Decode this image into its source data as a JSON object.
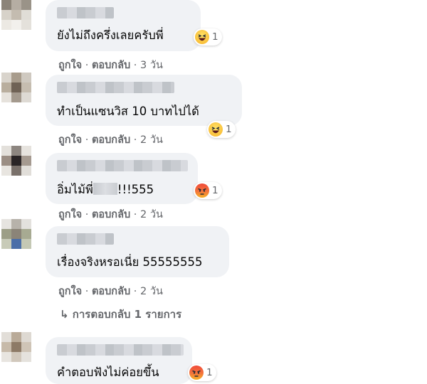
{
  "comments": [
    {
      "text": "ยังไม่ถึงครึ่งเลยครับพี่",
      "reaction": {
        "icon": "haha-emoji-icon",
        "count": "1"
      },
      "actions": {
        "like": "ถูกใจ",
        "sep": " · ",
        "reply": "ตอบกลับ",
        "time": "3 วัน"
      }
    },
    {
      "text": "ทำเป็นแซนวิส 10 บาทไปได้",
      "reaction": {
        "icon": "haha-emoji-icon",
        "count": "1"
      },
      "actions": {
        "like": "ถูกใจ",
        "sep": " · ",
        "reply": "ตอบกลับ",
        "time": "2 วัน"
      }
    },
    {
      "text_before": "อิ่มไม้พี่",
      "text_after": "!!!555",
      "reaction": {
        "icon": "angry-emoji-icon",
        "count": "1"
      },
      "actions": {
        "like": "ถูกใจ",
        "sep": " · ",
        "reply": "ตอบกลับ",
        "time": "2 วัน"
      }
    },
    {
      "text": "เรื่องจริงหรอเนี่ย 55555555",
      "actions": {
        "like": "ถูกใจ",
        "sep": " · ",
        "reply": "ตอบกลับ",
        "time": "2 วัน"
      },
      "replies_link": "↳ การตอบกลับ 1 รายการ"
    },
    {
      "text": "คำตอบฟังไม่ค่อยขึ้น",
      "reaction": {
        "icon": "angry-emoji-icon",
        "count": "1"
      }
    }
  ]
}
